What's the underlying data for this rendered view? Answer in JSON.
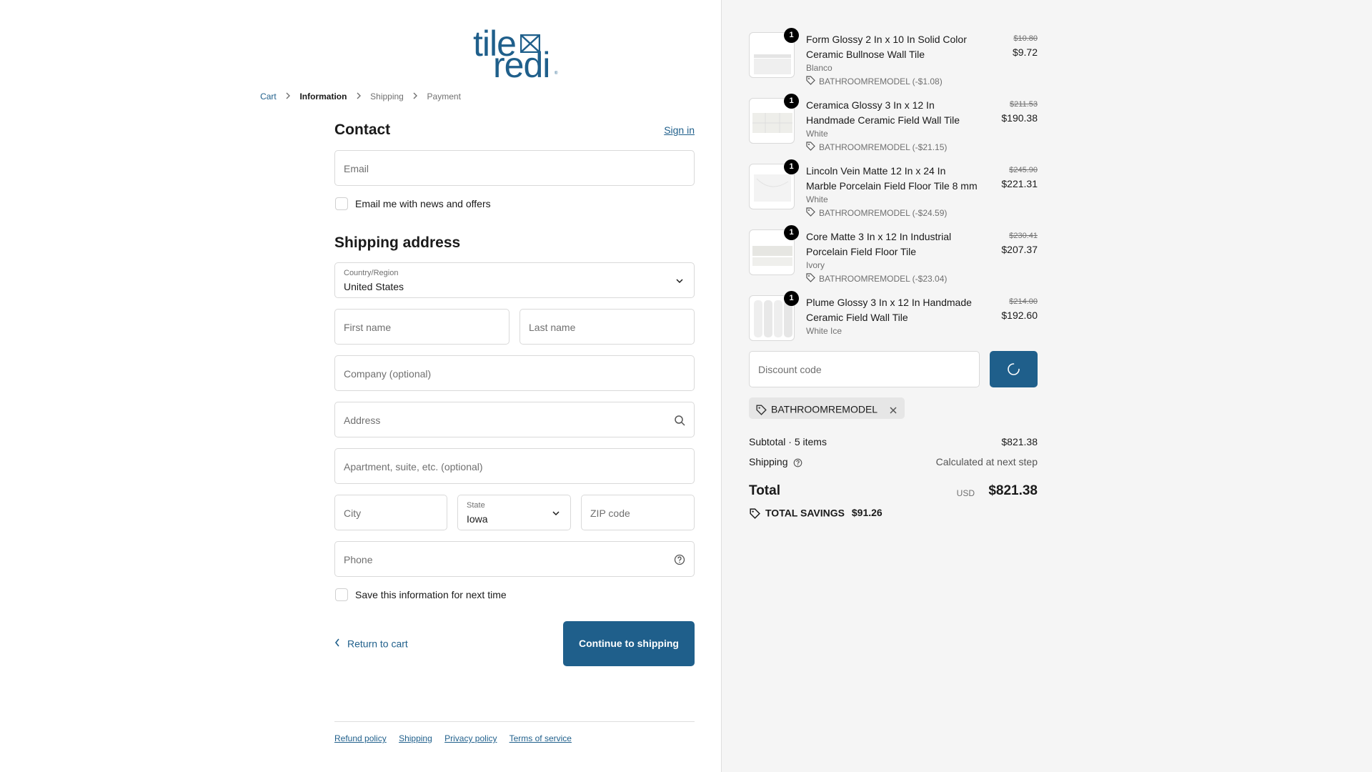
{
  "brand": {
    "logo_top": "tile",
    "logo_bottom": "redi",
    "accent": "#1f5f8b"
  },
  "breadcrumb": {
    "cart": "Cart",
    "information": "Information",
    "shipping": "Shipping",
    "payment": "Payment"
  },
  "contact": {
    "heading": "Contact",
    "sign_in": "Sign in",
    "email_placeholder": "Email",
    "newsletter_label": "Email me with news and offers"
  },
  "shipping_address": {
    "heading": "Shipping address",
    "country_label": "Country/Region",
    "country_value": "United States",
    "first_name_placeholder": "First name",
    "last_name_placeholder": "Last name",
    "company_placeholder": "Company (optional)",
    "address_placeholder": "Address",
    "apartment_placeholder": "Apartment, suite, etc. (optional)",
    "city_placeholder": "City",
    "state_label": "State",
    "state_value": "Iowa",
    "zip_placeholder": "ZIP code",
    "phone_placeholder": "Phone",
    "save_label": "Save this information for next time"
  },
  "actions": {
    "return": "Return to cart",
    "continue": "Continue to shipping"
  },
  "footer": {
    "refund": "Refund policy",
    "shipping": "Shipping",
    "privacy": "Privacy policy",
    "terms": "Terms of service"
  },
  "order": {
    "items": [
      {
        "qty": "1",
        "name": "Form Glossy 2 In x 10 In Solid Color Ceramic Bullnose Wall Tile",
        "variant": "Blanco",
        "discount": "BATHROOMREMODEL (-$1.08)",
        "old_price": "$10.80",
        "price": "$9.72"
      },
      {
        "qty": "1",
        "name": "Ceramica Glossy 3 In x 12 In Handmade Ceramic Field Wall Tile",
        "variant": "White",
        "discount": "BATHROOMREMODEL (-$21.15)",
        "old_price": "$211.53",
        "price": "$190.38"
      },
      {
        "qty": "1",
        "name": "Lincoln Vein Matte 12 In x 24 In Marble Porcelain Field Floor Tile 8 mm",
        "variant": "White",
        "discount": "BATHROOMREMODEL (-$24.59)",
        "old_price": "$245.90",
        "price": "$221.31"
      },
      {
        "qty": "1",
        "name": "Core Matte 3 In x 12 In Industrial Porcelain Field Floor Tile",
        "variant": "Ivory",
        "discount": "BATHROOMREMODEL (-$23.04)",
        "old_price": "$230.41",
        "price": "$207.37"
      },
      {
        "qty": "1",
        "name": "Plume Glossy 3 In x 12 In Handmade Ceramic Field Wall Tile",
        "variant": "White Ice",
        "old_price": "$214.00",
        "price": "$192.60"
      }
    ],
    "discount_placeholder": "Discount code",
    "applied_code": "BATHROOMREMODEL",
    "subtotal_label": "Subtotal · 5 items",
    "subtotal_value": "$821.38",
    "shipping_label": "Shipping",
    "shipping_value": "Calculated at next step",
    "total_label": "Total",
    "currency": "USD",
    "total_value": "$821.38",
    "savings_label": "TOTAL SAVINGS",
    "savings_value": "$91.26"
  }
}
